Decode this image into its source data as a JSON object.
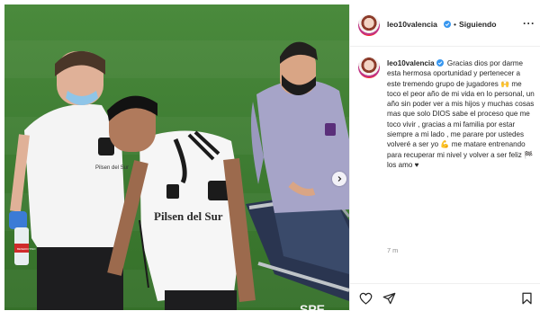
{
  "header": {
    "username": "leo10valencia",
    "separator": "•",
    "follow_state": "Siguiendo",
    "more_label": "···"
  },
  "caption": {
    "username": "leo10valencia",
    "text_1": "Gracias dios por darme esta hermosa oportunidad y pertenecer a este tremendo grupo de jugadores",
    "emoji_1": "🙌",
    "text_2": "me toco el peor año de mi vida en lo personal, un año sin poder ver a mis hijos y muchas cosas mas que solo DIOS sabe el proceso que me toco vivir , gracias a mi familia por estar siempre a mi lado , me parare por ustedes volveré a ser yo",
    "emoji_2": "💪",
    "text_3": "me matare entrenando para recuperar mi nivel y volver a ser feliz",
    "emoji_3": "🏁",
    "text_4": "los amo ♥",
    "time": "7 m"
  },
  "photo": {
    "jersey_sponsor": "Pilsen del Sur",
    "brand_right": "SPE",
    "bottle_label": "BENEDICTINO"
  },
  "colors": {
    "verified": "#3897f0",
    "pitch": "#3f7d33",
    "secondary_text": "#8e8e8e"
  },
  "icons": {
    "like": "heart-icon",
    "share": "send-icon",
    "save": "bookmark-icon",
    "next": "chevron-right-icon"
  }
}
